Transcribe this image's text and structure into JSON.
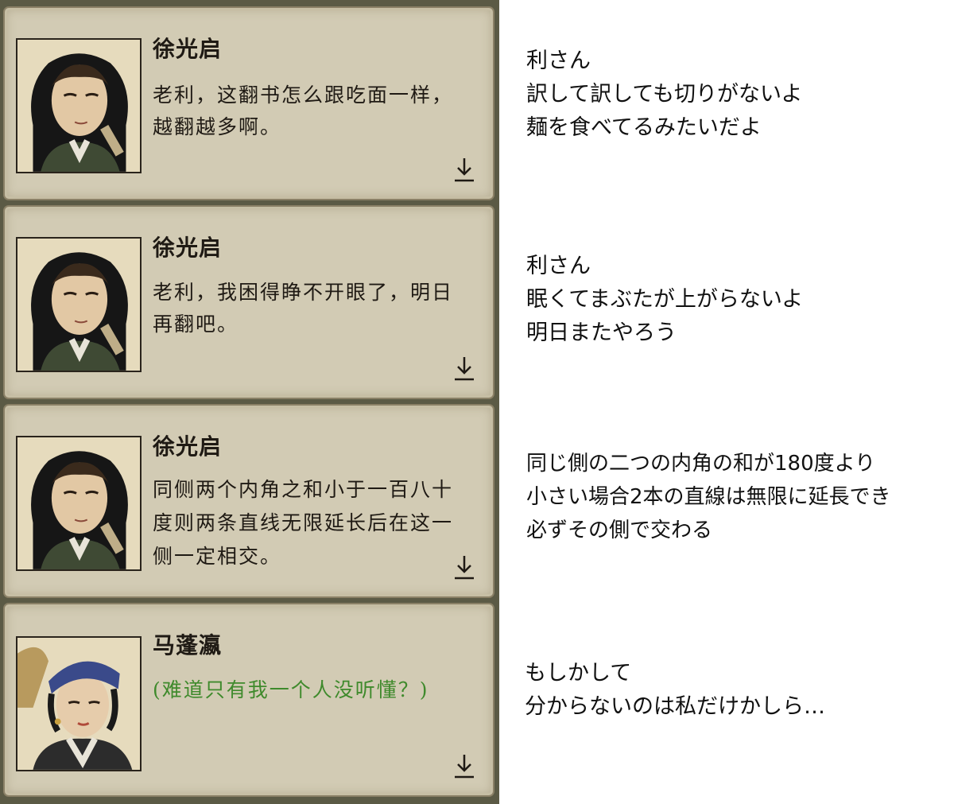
{
  "dialogues": [
    {
      "speaker": "徐光启",
      "lines": [
        "老利，这翻书怎么跟吃面一样，",
        "越翻越多啊。"
      ],
      "continue_icon": "down-arrow-icon",
      "translation": [
        "利さん",
        "訳して訳しても切りがないよ",
        "麺を食べてるみたいだよ"
      ]
    },
    {
      "speaker": "徐光启",
      "lines": [
        "老利，我困得睁不开眼了，明日",
        "再翻吧。"
      ],
      "continue_icon": "down-arrow-icon",
      "translation": [
        "利さん",
        "眠くてまぶたが上がらないよ",
        "明日またやろう"
      ]
    },
    {
      "speaker": "徐光启",
      "lines": [
        "同侧两个内角之和小于一百八十",
        "度则两条直线无限延长后在这一",
        "侧一定相交。"
      ],
      "continue_icon": "down-arrow-icon",
      "translation": [
        "同じ側の二つの内角の和が180度より",
        "小さい場合2本の直線は無限に延長でき",
        "必ずその側で交わる"
      ]
    },
    {
      "speaker": "马蓬瀛",
      "lines": [
        "(难道只有我一个人没听懂？)"
      ],
      "continue_icon": "down-arrow-icon",
      "translation": [
        "もしかして",
        "分からないのは私だけかしら…"
      ]
    }
  ],
  "colors": {
    "card": "#d2cbb4",
    "text": "#1f1a14",
    "thought_text": "#3f8a2c"
  }
}
